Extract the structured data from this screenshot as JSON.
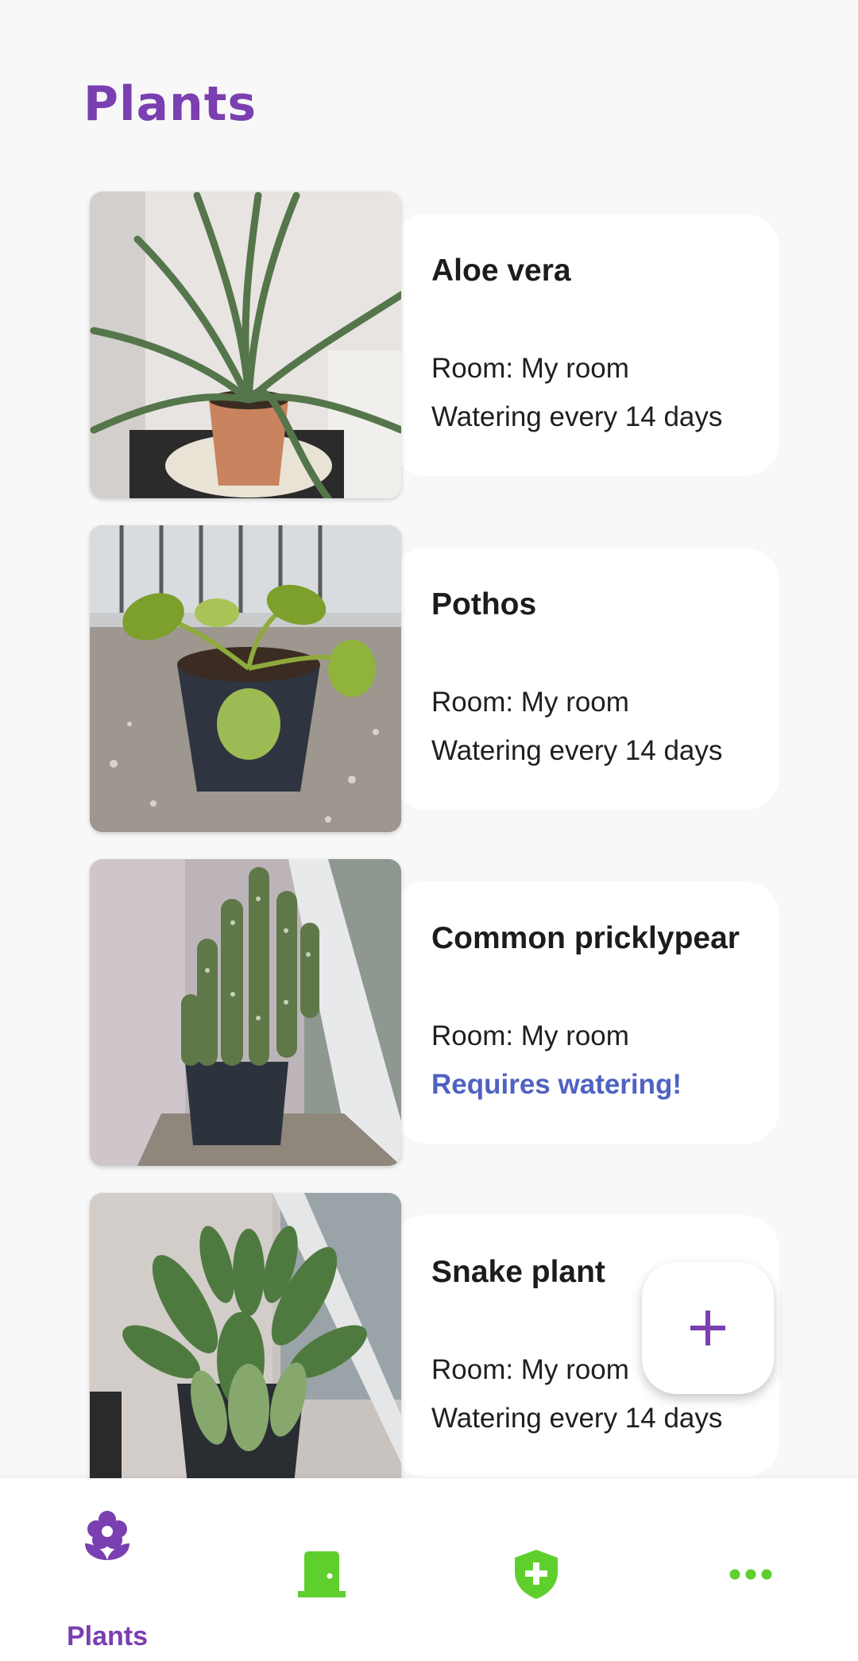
{
  "header": {
    "title": "Plants"
  },
  "plants": [
    {
      "name": "Aloe vera",
      "room": "Room: My room",
      "watering": "Watering every 14 days",
      "needs_water": false
    },
    {
      "name": "Pothos",
      "room": "Room: My room",
      "watering": "Watering every 14 days",
      "needs_water": false
    },
    {
      "name": "Common pricklypear",
      "room": "Room: My room",
      "watering": "Requires watering!",
      "needs_water": true
    },
    {
      "name": "Snake plant",
      "room": "Room: My room",
      "watering": "Watering every 14 days",
      "needs_water": false
    }
  ],
  "fab": {
    "icon": "plus-icon"
  },
  "bottom_nav": {
    "items": [
      {
        "label": "Plants",
        "icon": "flower-icon",
        "active": true
      },
      {
        "label": "",
        "icon": "door-icon",
        "active": false
      },
      {
        "label": "",
        "icon": "shield-plus-icon",
        "active": false
      },
      {
        "label": "",
        "icon": "more-horizontal-icon",
        "active": false
      }
    ]
  },
  "colors": {
    "accent_purple": "#7a3fb0",
    "alert_blue": "#4f62c2",
    "nav_green": "#5fcf2e",
    "background": "#f8f8f8"
  }
}
